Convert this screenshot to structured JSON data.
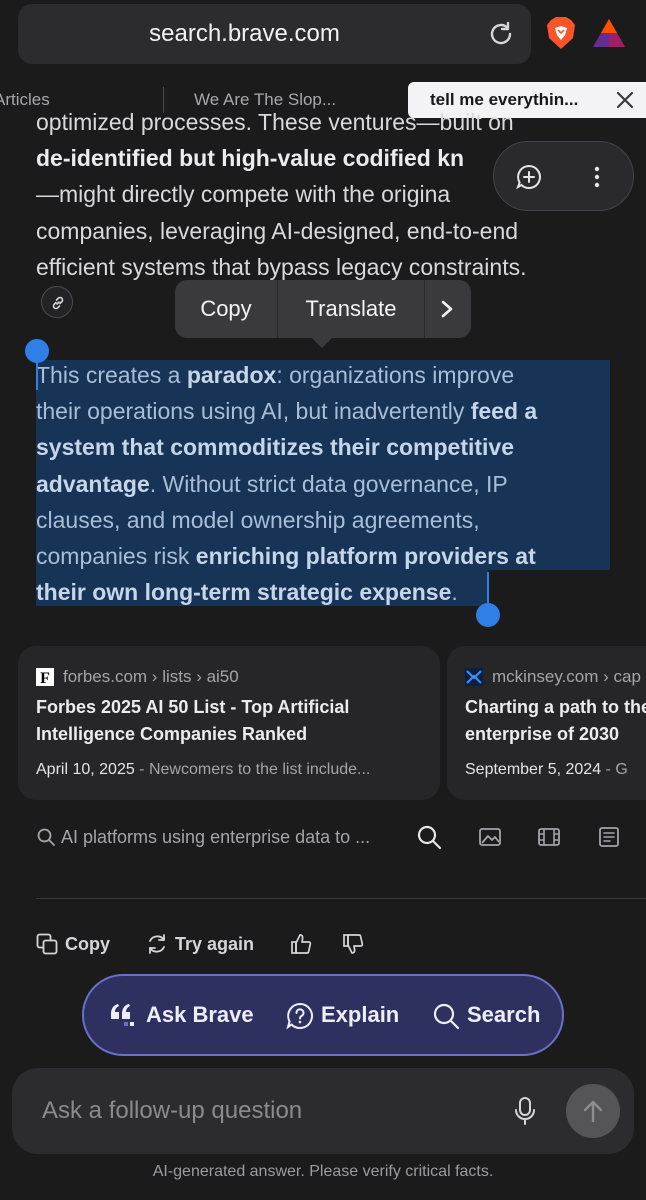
{
  "browser": {
    "url": "search.brave.com",
    "icons": [
      "reload-icon",
      "brave-lion-icon",
      "bat-rewards-icon"
    ]
  },
  "tabs": [
    {
      "label": "Articles"
    },
    {
      "label": "We Are The Slop..."
    },
    {
      "label": "tell me everythin...",
      "active": true
    }
  ],
  "article": {
    "top_lines": [
      {
        "pre": "optimized processes. These ventures—built on",
        "bold": "",
        "post": ""
      },
      {
        "pre": "",
        "bold": "de-identified but high-value codified kn",
        "post": ""
      },
      {
        "pre": "—might directly compete with the origina",
        "bold": "",
        "post": ""
      },
      {
        "pre": "companies, leveraging AI-designed, end-to-end",
        "bold": "",
        "post": ""
      },
      {
        "pre": "efficient systems that bypass legacy constraints.",
        "bold": "",
        "post": ""
      }
    ],
    "selected_lines": [
      {
        "pre": "This creates a ",
        "bold": "paradox",
        "post": ": organizations improve"
      },
      {
        "pre": "their operations using AI, but inadvertently ",
        "bold": "feed a",
        "post": ""
      },
      {
        "pre": "",
        "bold": "system that commoditizes their competitive",
        "post": ""
      },
      {
        "pre": "",
        "bold": "advantage",
        "post": ". Without strict data governance, IP"
      },
      {
        "pre": "clauses, and model ownership agreements,",
        "bold": "",
        "post": ""
      },
      {
        "pre": "companies risk ",
        "bold": "enriching platform providers at",
        "post": ""
      },
      {
        "pre": "",
        "bold": "their own long-term strategic expense",
        "post": "."
      }
    ]
  },
  "context_menu": {
    "copy": "Copy",
    "translate": "Translate"
  },
  "sources": [
    {
      "favicon": "F",
      "path": "forbes.com › lists › ai50",
      "title_lines": [
        "Forbes 2025 AI 50 List - Top Artificial",
        "Intelligence Companies Ranked"
      ],
      "date": "April 10, 2025",
      "snippet": " - Newcomers to the list include..."
    },
    {
      "favicon": "mckinsey-logo-icon",
      "path": "mckinsey.com › cap",
      "title_lines": [
        "Charting a path to the",
        "enterprise of 2030"
      ],
      "date": "September 5, 2024",
      "snippet": " - G"
    }
  ],
  "related": {
    "query": "AI platforms using enterprise data to ..."
  },
  "actions": {
    "copy": "Copy",
    "try_again": "Try again"
  },
  "pill": {
    "ask": "Ask Brave",
    "explain": "Explain",
    "search": "Search"
  },
  "followup": {
    "placeholder": "Ask a follow-up question"
  },
  "disclaimer": "AI-generated answer. Please verify critical facts.",
  "colors": {
    "background": "#1b1b1c",
    "selection": "#173457",
    "handle": "#2f7fe6",
    "pill_bg": "#2e3160",
    "pill_border": "#6a6fc8"
  }
}
